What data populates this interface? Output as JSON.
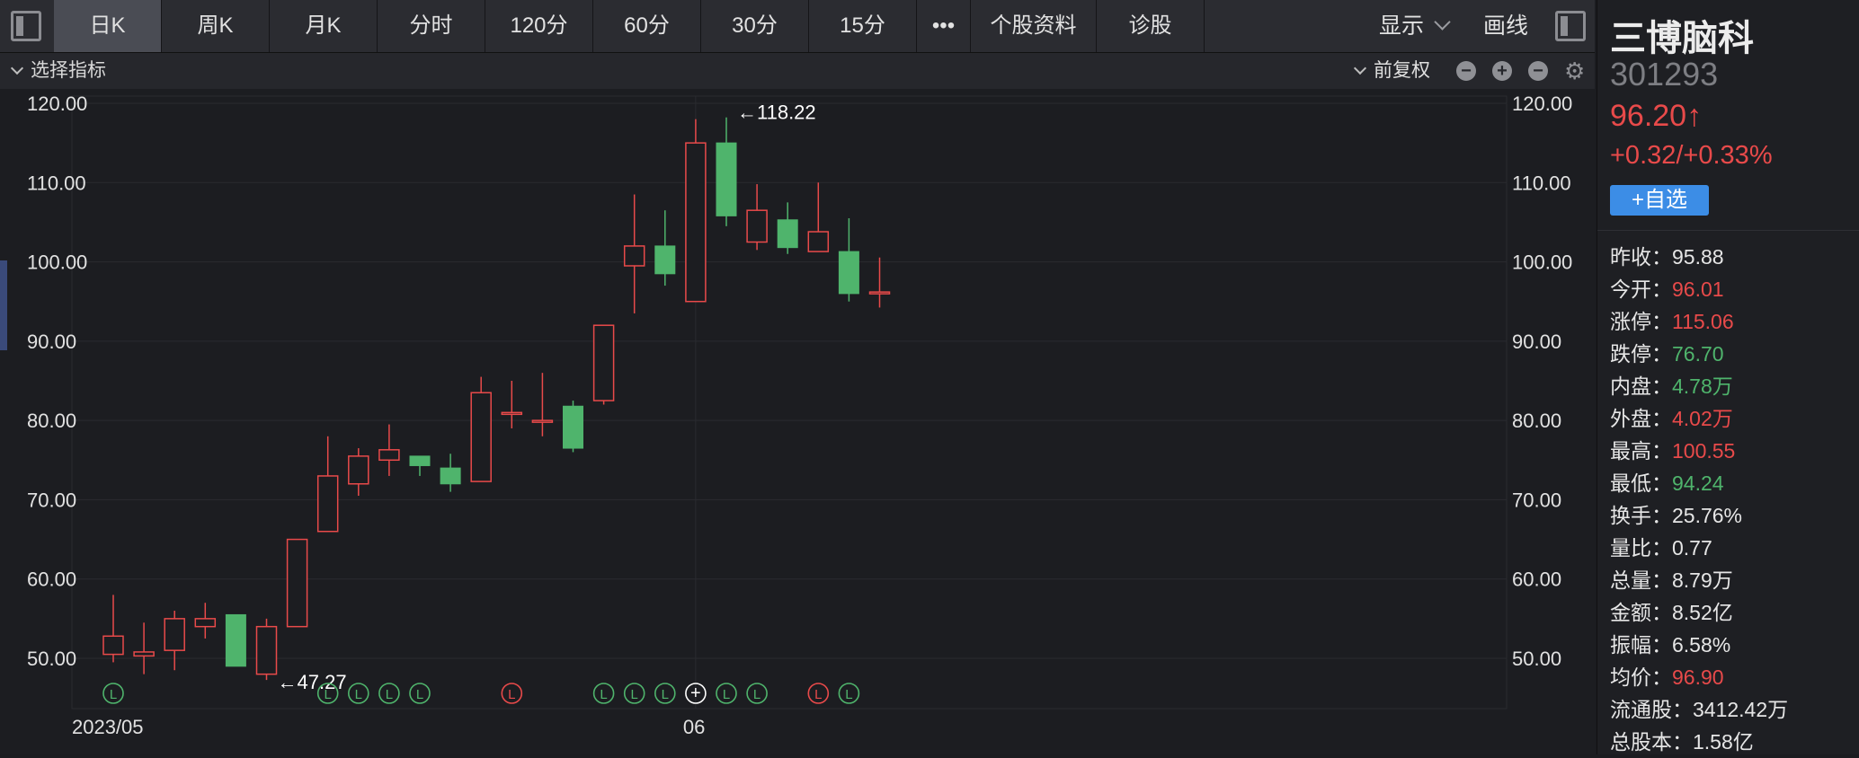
{
  "toolbar": {
    "tabs": [
      {
        "label": "日K",
        "active": true
      },
      {
        "label": "周K",
        "active": false
      },
      {
        "label": "月K",
        "active": false
      },
      {
        "label": "分时",
        "active": false
      },
      {
        "label": "120分",
        "active": false
      },
      {
        "label": "60分",
        "active": false
      },
      {
        "label": "30分",
        "active": false
      },
      {
        "label": "15分",
        "active": false
      },
      {
        "label": "•••",
        "active": false
      },
      {
        "label": "个股资料",
        "active": false
      },
      {
        "label": "诊股",
        "active": false
      }
    ],
    "display_label": "显示",
    "draw_label": "画线"
  },
  "indicator_bar": {
    "select_label": "选择指标",
    "adjust_label": "前复权",
    "controls": [
      "minus-circle-icon",
      "plus-circle-icon",
      "minus-circle-icon",
      "gear-icon"
    ]
  },
  "colors": {
    "up": "#e84a4a",
    "down": "#4fb46c",
    "button": "#3c8de6"
  },
  "chart_data": {
    "type": "candlestick",
    "y_ticks": [
      "120.00",
      "110.00",
      "100.00",
      "90.00",
      "80.00",
      "70.00",
      "60.00",
      "50.00"
    ],
    "ylim": [
      47,
      121
    ],
    "x_labels": [
      {
        "label": "2023/05",
        "index": 0
      },
      {
        "label": "06",
        "index": 19
      }
    ],
    "candles": [
      {
        "o": 50.5,
        "h": 58.0,
        "l": 49.5,
        "c": 52.8
      },
      {
        "o": 50.3,
        "h": 54.5,
        "l": 48.0,
        "c": 50.8
      },
      {
        "o": 51.0,
        "h": 56.0,
        "l": 48.5,
        "c": 55.0
      },
      {
        "o": 54.0,
        "h": 57.0,
        "l": 52.5,
        "c": 55.0
      },
      {
        "o": 55.5,
        "h": 55.5,
        "l": 49.0,
        "c": 49.0
      },
      {
        "o": 48.0,
        "h": 55.0,
        "l": 47.27,
        "c": 54.0
      },
      {
        "o": 54.0,
        "h": 65.0,
        "l": 54.0,
        "c": 65.0
      },
      {
        "o": 66.0,
        "h": 78.0,
        "l": 66.0,
        "c": 73.0
      },
      {
        "o": 72.0,
        "h": 76.5,
        "l": 70.5,
        "c": 75.5
      },
      {
        "o": 75.0,
        "h": 79.5,
        "l": 73.0,
        "c": 76.3
      },
      {
        "o": 75.5,
        "h": 75.5,
        "l": 73.0,
        "c": 74.3
      },
      {
        "o": 74.0,
        "h": 75.8,
        "l": 71.0,
        "c": 72.0
      },
      {
        "o": 72.3,
        "h": 85.5,
        "l": 72.3,
        "c": 83.5
      },
      {
        "o": 81.0,
        "h": 85.0,
        "l": 79.0,
        "c": 81.0
      },
      {
        "o": 80.0,
        "h": 86.0,
        "l": 78.0,
        "c": 80.0
      },
      {
        "o": 81.8,
        "h": 82.5,
        "l": 76.0,
        "c": 76.5
      },
      {
        "o": 82.5,
        "h": 92.0,
        "l": 82.0,
        "c": 92.0
      },
      {
        "o": 99.5,
        "h": 108.5,
        "l": 93.5,
        "c": 102.0
      },
      {
        "o": 102.0,
        "h": 106.5,
        "l": 97.0,
        "c": 98.5
      },
      {
        "o": 95.0,
        "h": 118.0,
        "l": 95.0,
        "c": 115.0
      },
      {
        "o": 115.0,
        "h": 118.22,
        "l": 104.5,
        "c": 105.8
      },
      {
        "o": 102.5,
        "h": 109.8,
        "l": 101.5,
        "c": 106.5
      },
      {
        "o": 105.3,
        "h": 107.5,
        "l": 101.0,
        "c": 101.8
      },
      {
        "o": 101.3,
        "h": 110.0,
        "l": 101.3,
        "c": 103.8
      },
      {
        "o": 101.3,
        "h": 105.5,
        "l": 95.0,
        "c": 96.0
      },
      {
        "o": 96.01,
        "h": 100.55,
        "l": 94.24,
        "c": 96.2
      }
    ],
    "annotations": [
      {
        "text": "←118.22",
        "index": 20,
        "value": 118.22,
        "position": "high"
      },
      {
        "text": "←47.27",
        "index": 5,
        "value": 47.27,
        "position": "low"
      }
    ],
    "markers": [
      {
        "index": 0,
        "type": "L",
        "color": "green"
      },
      {
        "index": 7,
        "type": "L",
        "color": "green"
      },
      {
        "index": 8,
        "type": "L",
        "color": "green"
      },
      {
        "index": 9,
        "type": "L",
        "color": "green"
      },
      {
        "index": 10,
        "type": "L",
        "color": "green"
      },
      {
        "index": 13,
        "type": "L",
        "color": "red"
      },
      {
        "index": 16,
        "type": "L",
        "color": "green"
      },
      {
        "index": 17,
        "type": "L",
        "color": "green"
      },
      {
        "index": 18,
        "type": "L",
        "color": "green"
      },
      {
        "index": 19,
        "type": "+",
        "color": "white"
      },
      {
        "index": 20,
        "type": "L",
        "color": "green"
      },
      {
        "index": 21,
        "type": "L",
        "color": "green"
      },
      {
        "index": 23,
        "type": "L",
        "color": "red"
      },
      {
        "index": 24,
        "type": "L",
        "color": "green"
      }
    ]
  },
  "stock": {
    "name": "三博脑科",
    "code": "301293",
    "price": "96.20↑",
    "change": "+0.32/+0.33%",
    "watch_label": "+自选"
  },
  "stats": [
    {
      "label": "昨收：",
      "value": "95.88",
      "color": "white"
    },
    {
      "label": "今开：",
      "value": "96.01",
      "color": "red"
    },
    {
      "label": "涨停：",
      "value": "115.06",
      "color": "red"
    },
    {
      "label": "跌停：",
      "value": "76.70",
      "color": "green"
    },
    {
      "label": "内盘：",
      "value": "4.78万",
      "color": "green"
    },
    {
      "label": "外盘：",
      "value": "4.02万",
      "color": "red"
    },
    {
      "label": "最高：",
      "value": "100.55",
      "color": "red"
    },
    {
      "label": "最低：",
      "value": "94.24",
      "color": "green"
    },
    {
      "label": "换手：",
      "value": "25.76%",
      "color": "white"
    },
    {
      "label": "量比：",
      "value": "0.77",
      "color": "white"
    },
    {
      "label": "总量：",
      "value": "8.79万",
      "color": "white"
    },
    {
      "label": "金额：",
      "value": "8.52亿",
      "color": "white"
    },
    {
      "label": "振幅：",
      "value": "6.58%",
      "color": "white"
    },
    {
      "label": "均价：",
      "value": "96.90",
      "color": "red"
    },
    {
      "label": "流通股：",
      "value": "3412.42万",
      "color": "white"
    },
    {
      "label": "总股本：",
      "value": "1.58亿",
      "color": "white"
    }
  ]
}
